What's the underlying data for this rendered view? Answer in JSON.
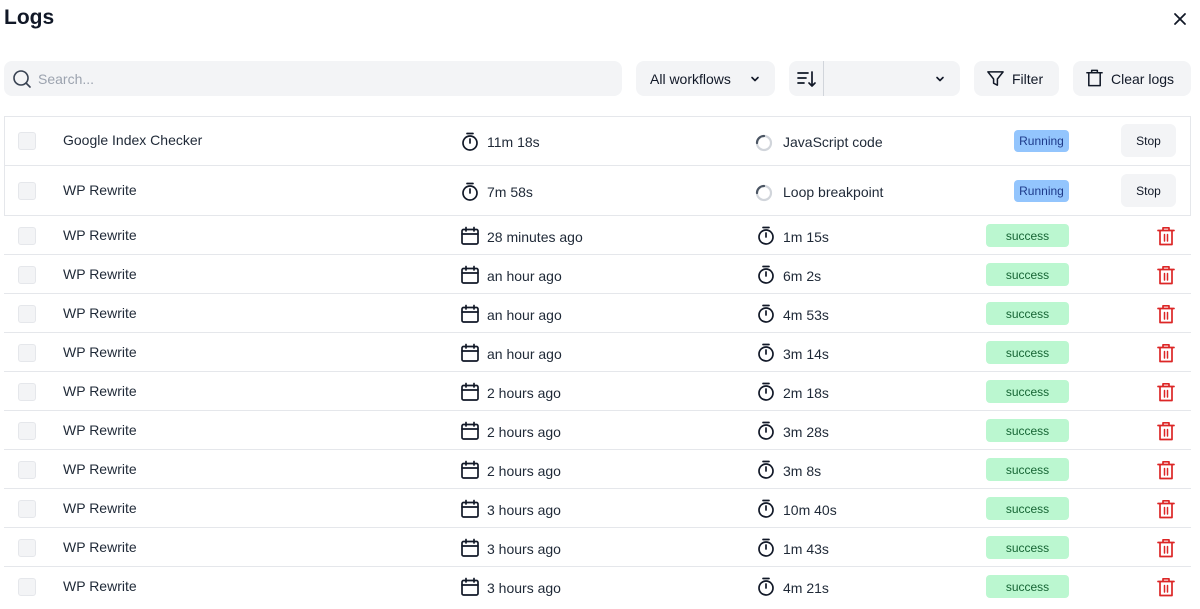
{
  "header": {
    "title": "Logs",
    "close_icon": "close-icon"
  },
  "toolbar": {
    "search_placeholder": "Search...",
    "workflow_select": "All workflows",
    "sort_value": "",
    "filter_label": "Filter",
    "clear_label": "Clear logs"
  },
  "running": [
    {
      "name": "Google Index Checker",
      "duration": "11m 18s",
      "step": "JavaScript code",
      "status": "Running",
      "action": "Stop"
    },
    {
      "name": "WP Rewrite",
      "duration": "7m 58s",
      "step": "Loop breakpoint",
      "status": "Running",
      "action": "Stop"
    }
  ],
  "logs": [
    {
      "name": "WP Rewrite",
      "time": "28 minutes ago",
      "duration": "1m 15s",
      "status": "success"
    },
    {
      "name": "WP Rewrite",
      "time": "an hour ago",
      "duration": "6m 2s",
      "status": "success"
    },
    {
      "name": "WP Rewrite",
      "time": "an hour ago",
      "duration": "4m 53s",
      "status": "success"
    },
    {
      "name": "WP Rewrite",
      "time": "an hour ago",
      "duration": "3m 14s",
      "status": "success"
    },
    {
      "name": "WP Rewrite",
      "time": "2 hours ago",
      "duration": "2m 18s",
      "status": "success"
    },
    {
      "name": "WP Rewrite",
      "time": "2 hours ago",
      "duration": "3m 28s",
      "status": "success"
    },
    {
      "name": "WP Rewrite",
      "time": "2 hours ago",
      "duration": "3m 8s",
      "status": "success"
    },
    {
      "name": "WP Rewrite",
      "time": "3 hours ago",
      "duration": "10m 40s",
      "status": "success"
    },
    {
      "name": "WP Rewrite",
      "time": "3 hours ago",
      "duration": "1m 43s",
      "status": "success"
    },
    {
      "name": "WP Rewrite",
      "time": "3 hours ago",
      "duration": "4m 21s",
      "status": "success"
    }
  ],
  "colors": {
    "running_badge": "#93c5fd",
    "success_badge": "#bbf7d0",
    "delete_icon": "#dc2626"
  }
}
